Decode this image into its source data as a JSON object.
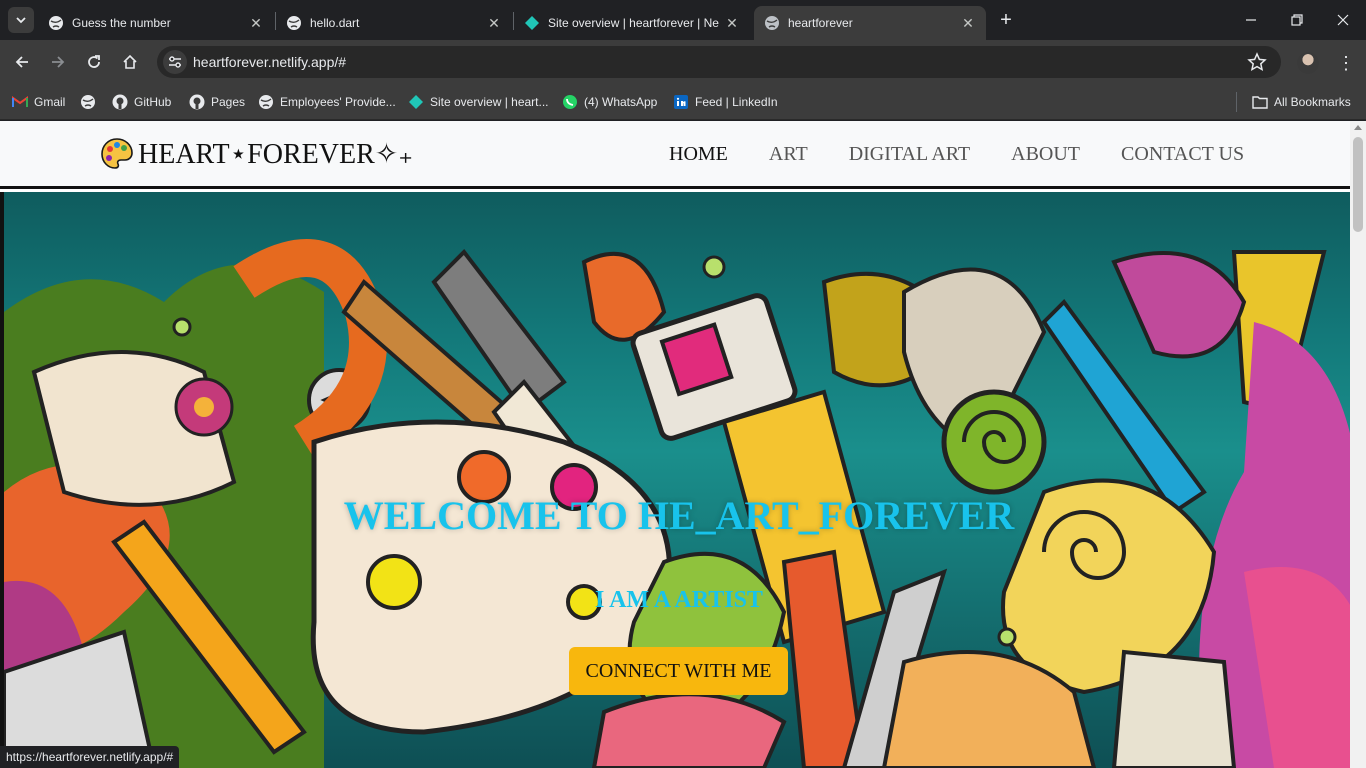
{
  "tabs": [
    {
      "title": "Guess the number",
      "icon": "globe-icon"
    },
    {
      "title": "hello.dart",
      "icon": "globe-icon"
    },
    {
      "title": "Site overview | heartforever | Ne",
      "icon": "netlify-icon"
    },
    {
      "title": "heartforever",
      "icon": "globe-icon",
      "active": true
    }
  ],
  "toolbar": {
    "url": "heartforever.netlify.app/#"
  },
  "bookmarks": [
    {
      "label": "Gmail",
      "icon": "gmail-icon"
    },
    {
      "label": "",
      "icon": "globe-icon"
    },
    {
      "label": "GitHub",
      "icon": "github-icon"
    },
    {
      "label": "Pages",
      "icon": "github-icon"
    },
    {
      "label": "Employees' Provide...",
      "icon": "globe-icon"
    },
    {
      "label": "Site overview | heart...",
      "icon": "netlify-icon"
    },
    {
      "label": "(4) WhatsApp",
      "icon": "whatsapp-icon"
    },
    {
      "label": "Feed | LinkedIn",
      "icon": "linkedin-icon"
    },
    {
      "label": "All Bookmarks",
      "icon": "folder-icon"
    }
  ],
  "site": {
    "logo_text": "HEART⋆FOREVER✧₊",
    "nav": [
      "HOME",
      "ART",
      "DIGITAL ART",
      "ABOUT",
      "CONTACT US"
    ],
    "hero_title": "WELCOME TO HE_ART_FOREVER",
    "hero_subtitle": "I AM A ARTIST",
    "hero_button": "CONNECT WITH ME"
  },
  "status_bar": {
    "link_url": "https://heartforever.netlify.app/#"
  },
  "colors": {
    "accent": "#18c3ec",
    "button": "#f8b70d",
    "chrome_dark": "#202124",
    "chrome_mid": "#3c3c3c"
  }
}
